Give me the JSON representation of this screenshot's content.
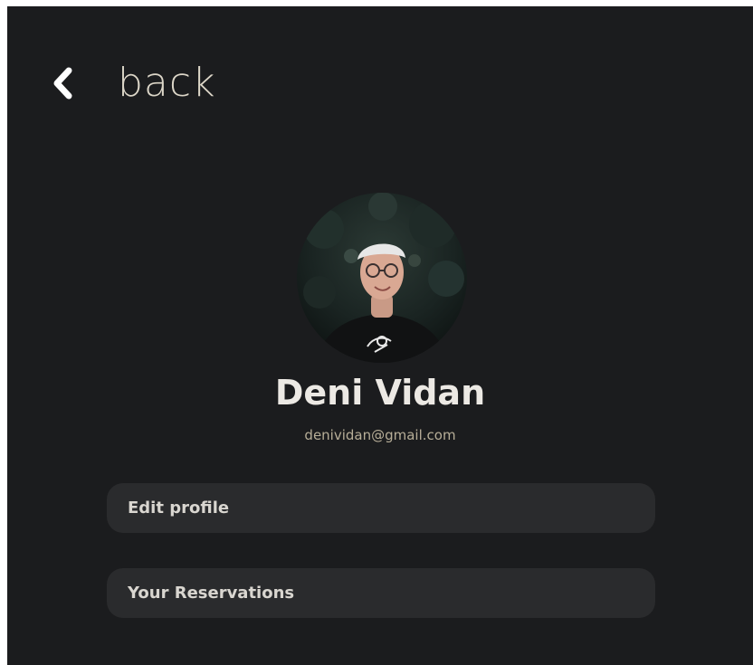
{
  "nav": {
    "back_label": "back",
    "back_icon": "chevron-left-icon"
  },
  "profile": {
    "name": "Deni Vidan",
    "email": "denividan@gmail.com",
    "avatar_icon": "user-photo"
  },
  "menu": {
    "items": [
      {
        "label": "Edit profile"
      },
      {
        "label": "Your Reservations"
      }
    ]
  },
  "colors": {
    "background": "#1b1c1e",
    "button": "#2a2b2d",
    "name_text": "#ece9e4",
    "accent_text": "#b7ae98"
  }
}
